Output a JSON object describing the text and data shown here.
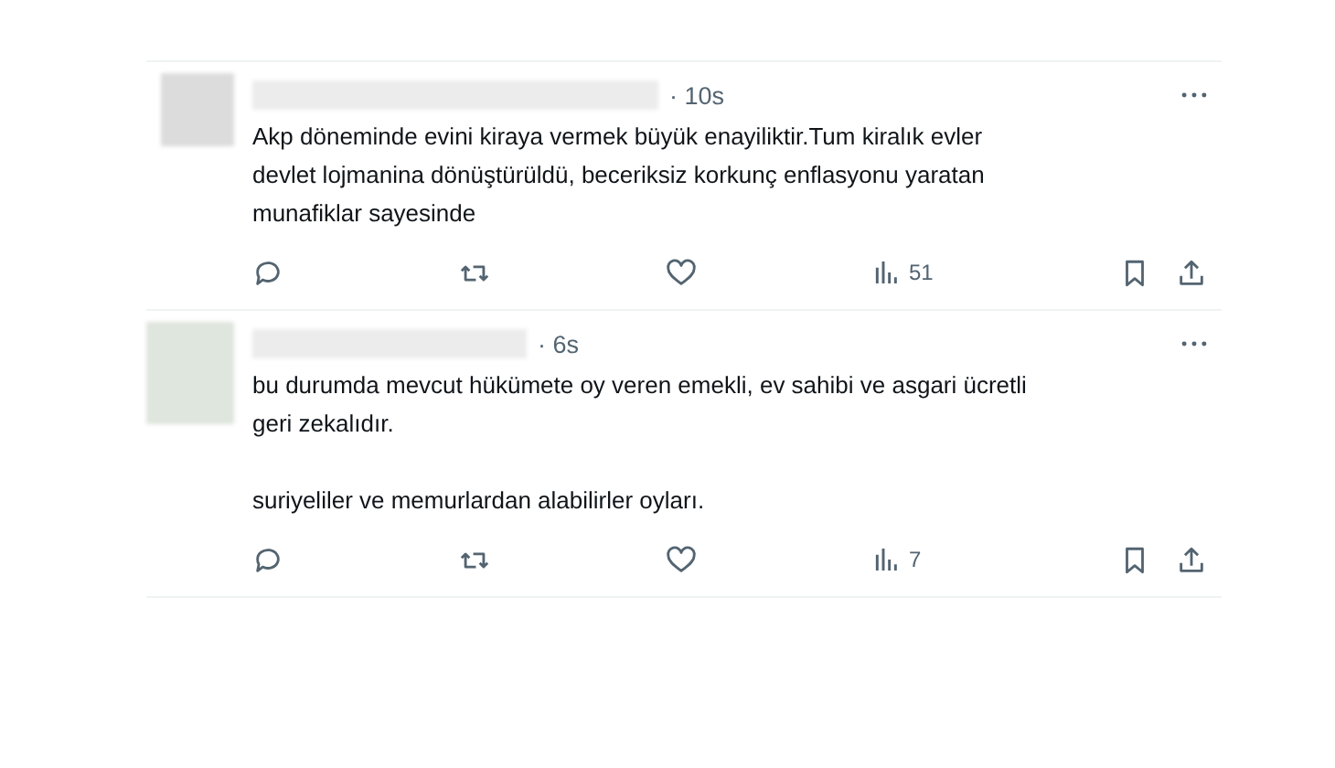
{
  "tweets": [
    {
      "time": "· 10s",
      "paragraphs": [
        "Akp döneminde evini kiraya vermek büyük enayiliktir.Tum kiralık evler\ndevlet lojmanina dönüştürüldü, beceriksiz korkunç enflasyonu yaratan\nmunafiklar sayesinde"
      ],
      "views": "51"
    },
    {
      "time": "· 6s",
      "paragraphs": [
        "bu durumda mevcut hükümete oy veren emekli, ev sahibi ve asgari ücretli\ngeri zekalıdır.",
        "suriyeliler ve memurlardan alabilirler oyları."
      ],
      "views": "7"
    }
  ]
}
